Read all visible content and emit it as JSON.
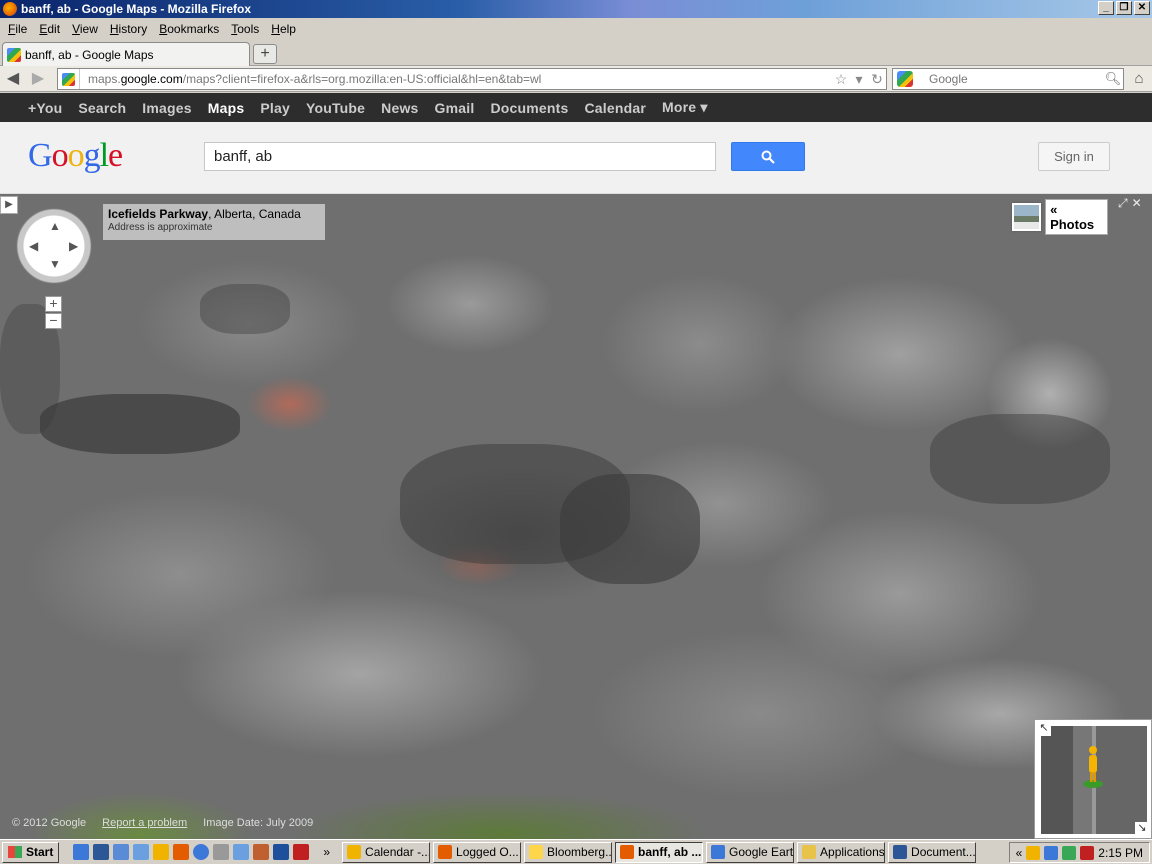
{
  "window": {
    "title": "banff, ab - Google Maps - Mozilla Firefox"
  },
  "menu": [
    "File",
    "Edit",
    "View",
    "History",
    "Bookmarks",
    "Tools",
    "Help"
  ],
  "tab": {
    "label": "banff, ab - Google Maps",
    "new_tab": "+"
  },
  "nav": {
    "url_prefix": "maps.",
    "url_domain": "google.com",
    "url_rest": "/maps?client=firefox-a&rls=org.mozilla:en-US:official&hl=en&tab=wl",
    "search_placeholder": "Google"
  },
  "gbar": [
    "+You",
    "Search",
    "Images",
    "Maps",
    "Play",
    "YouTube",
    "News",
    "Gmail",
    "Documents",
    "Calendar",
    "More ▾"
  ],
  "gbar_active": "Maps",
  "header": {
    "search_value": "banff, ab",
    "signin": "Sign in"
  },
  "streetview": {
    "address_bold": "Icefields Parkway",
    "address_rest": ", Alberta, Canada",
    "address_note": "Address is approximate",
    "photos_label": "« Photos",
    "copyright": "© 2012 Google",
    "report": "Report a problem",
    "image_date": "Image Date: July 2009"
  },
  "taskbar": {
    "start": "Start",
    "chevron": "»",
    "items": [
      {
        "label": "Calendar -...",
        "color": "#f0b400",
        "active": false
      },
      {
        "label": "Logged O...",
        "color": "#e35d00",
        "active": false
      },
      {
        "label": "Bloomberg...",
        "color": "#ffd54a",
        "active": false
      },
      {
        "label": "banff, ab ...",
        "color": "#e35d00",
        "active": true
      },
      {
        "label": "Google Earth",
        "color": "#3b78d8",
        "active": false
      },
      {
        "label": "Applications",
        "color": "#e8c34a",
        "active": false
      },
      {
        "label": "Document...",
        "color": "#2b5797",
        "active": false
      }
    ],
    "tray_chevron": "«",
    "clock": "2:15 PM"
  }
}
